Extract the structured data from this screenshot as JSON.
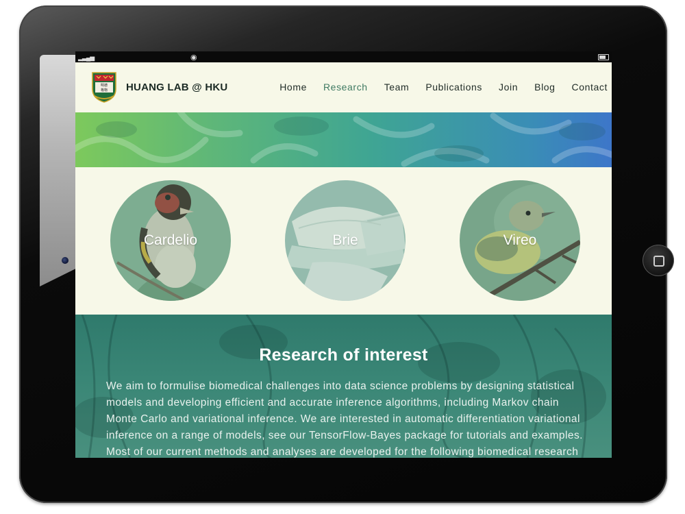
{
  "nav": {
    "brand": "HUANG LAB @ HKU",
    "links": [
      {
        "label": "Home"
      },
      {
        "label": "Research",
        "active": true
      },
      {
        "label": "Team"
      },
      {
        "label": "Publications"
      },
      {
        "label": "Join"
      },
      {
        "label": "Blog"
      },
      {
        "label": "Contact"
      }
    ],
    "active_color": "#3f7a62"
  },
  "projects": [
    {
      "label": "Cardelio"
    },
    {
      "label": "Brie"
    },
    {
      "label": "Vireo"
    }
  ],
  "research": {
    "title": "Research of interest",
    "text": "We aim to formulise biomedical challenges into data science problems by designing statistical models and developing efficient and accurate inference algorithms, including Markov chain Monte Carlo and variational inference. We are interested in automatic differentiation variational inference on a range of models, see our TensorFlow-Bayes package for tutorials and examples. Most of our current methods and analyses are developed for the following biomedical research"
  },
  "colors": {
    "page_background": "#f7f8e8",
    "research_background": "#3a8676"
  }
}
